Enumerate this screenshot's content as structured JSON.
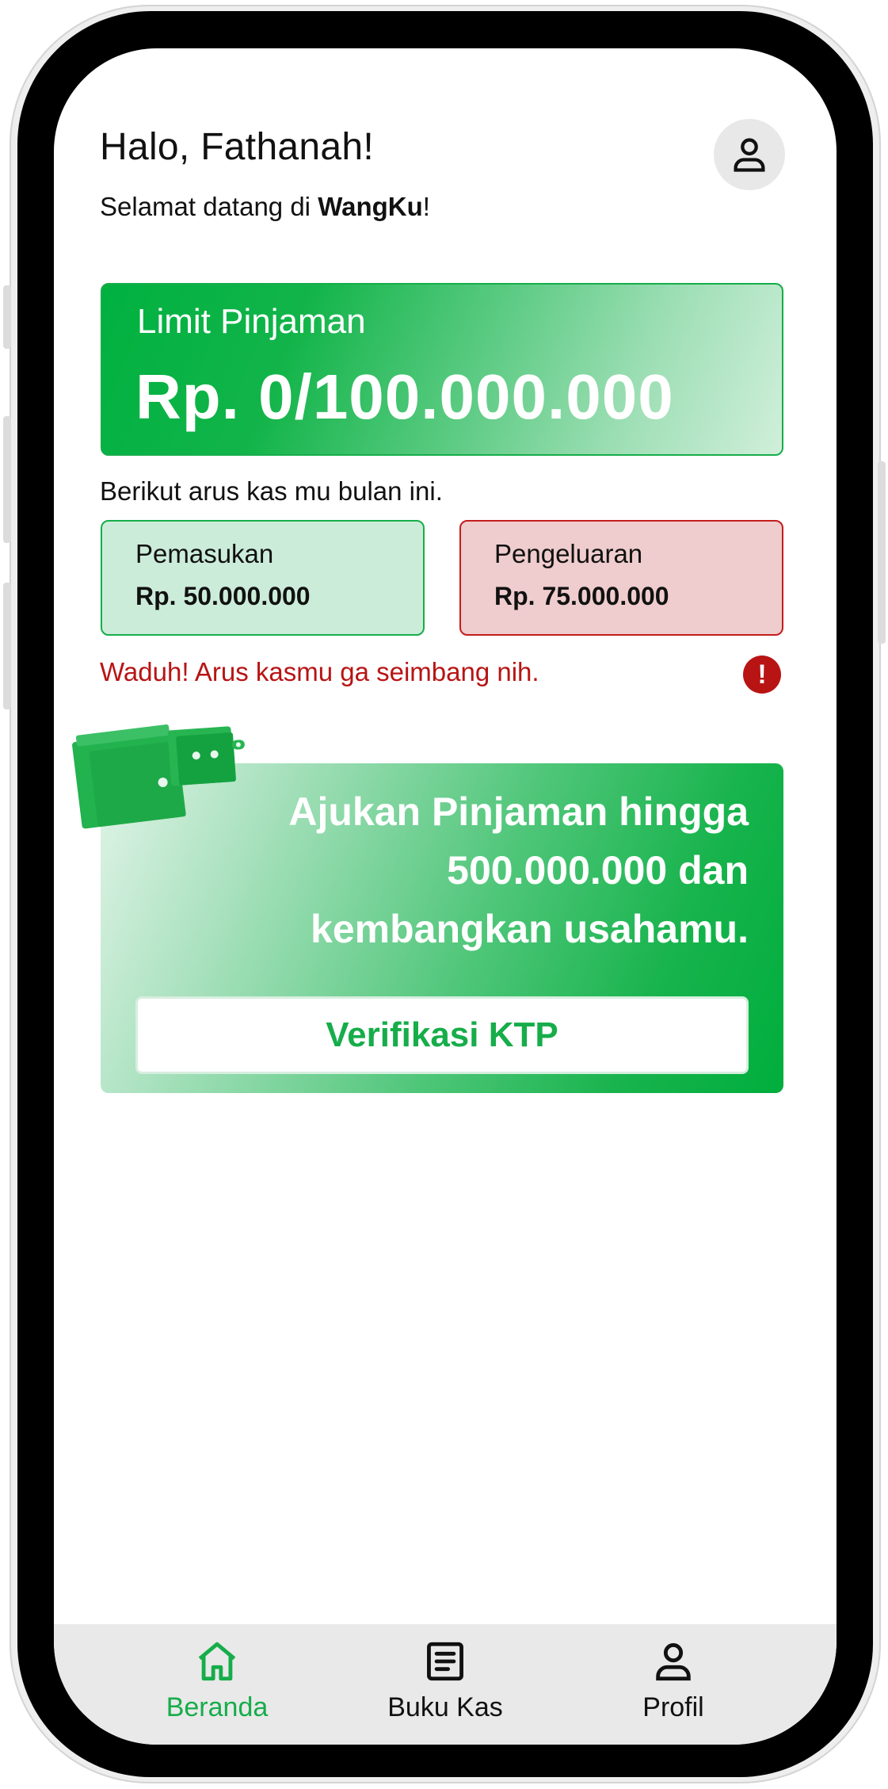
{
  "header": {
    "greeting": "Halo, Fathanah!",
    "welcome_prefix": "Selamat datang di ",
    "brand": "WangKu",
    "welcome_suffix": "!",
    "profile_icon": "user-icon"
  },
  "limit": {
    "label": "Limit Pinjaman",
    "value": "Rp. 0/100.000.000"
  },
  "cashflow": {
    "intro": "Berikut arus kas mu bulan ini.",
    "income": {
      "label": "Pemasukan",
      "value": "Rp. 50.000.000"
    },
    "expense": {
      "label": "Pengeluaran",
      "value": "Rp. 75.000.000"
    },
    "warning": "Waduh! Arus kasmu ga seimbang nih.",
    "warning_icon": "alert-icon",
    "warning_icon_glyph": "!"
  },
  "promo": {
    "lines": [
      "Ajukan Pinjaman hingga",
      "500.000.000 dan",
      "kembangkan usahamu."
    ],
    "button_label": "Verifikasi KTP",
    "illustration": "wallet-icon"
  },
  "nav": {
    "items": [
      {
        "label": "Beranda",
        "icon": "home-icon",
        "active": true
      },
      {
        "label": "Buku Kas",
        "icon": "ledger-icon",
        "active": false
      },
      {
        "label": "Profil",
        "icon": "user-icon",
        "active": false
      }
    ]
  },
  "colors": {
    "accent_green": "#16ad4a",
    "danger_red": "#b81414",
    "income_bg": "#ccecda",
    "expense_bg": "#efcccd",
    "nav_bg": "#e9e9e9"
  }
}
